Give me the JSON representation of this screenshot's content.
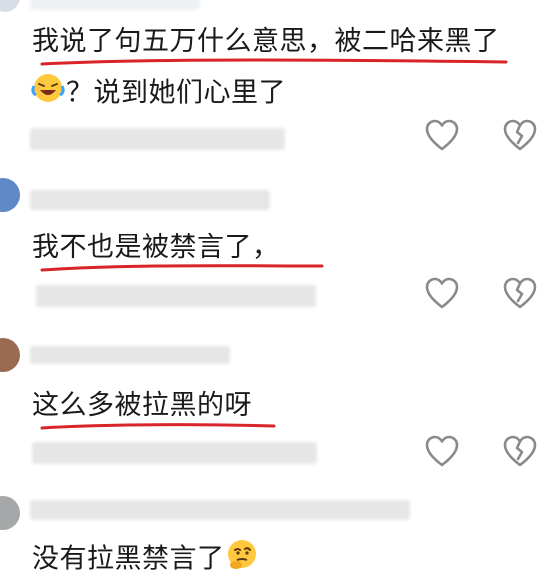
{
  "comments": [
    {
      "text": "我说了句五万什么意思，被二哈来黑了",
      "text_line2": "？说到她们心里了",
      "emoji": "laughing-crying-emoji"
    },
    {
      "text": "我不也是被禁言了，"
    },
    {
      "text": "这么多被拉黑的呀"
    },
    {
      "text": "没有拉黑禁言了",
      "emoji": "thinking-face-emoji"
    }
  ],
  "icons": [
    "heart-outline-icon",
    "broken-heart-icon"
  ],
  "colors": {
    "underline": "#d9252a",
    "icon_stroke": "#8a8a8a",
    "text": "#1a1a1a",
    "blurred_meta": "#e3e3e3"
  }
}
